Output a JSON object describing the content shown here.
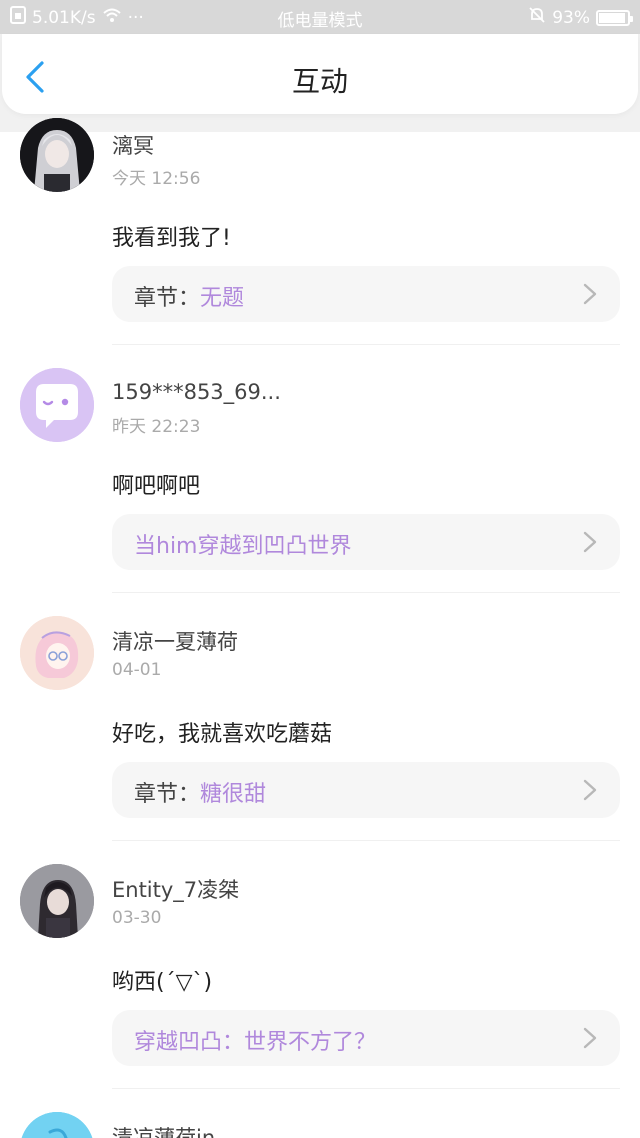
{
  "status_bar": {
    "network_speed": "5.01K/s",
    "dots": "···",
    "mode": "低电量模式",
    "battery_percent": "93%",
    "battery_level": 0.93
  },
  "header": {
    "title": "互动"
  },
  "comments": [
    {
      "name": "漓冥",
      "time": "今天 12:56",
      "text": "我看到我了!",
      "link_prefix": "章节：",
      "link_value": "无题"
    },
    {
      "name": "159***853_69...",
      "time": "昨天 22:23",
      "text": "啊吧啊吧",
      "link_prefix": "",
      "link_value": "当him穿越到凹凸世界"
    },
    {
      "name": "清凉一夏薄荷",
      "time": "04-01",
      "text": "好吃，我就喜欢吃蘑菇",
      "link_prefix": "章节：",
      "link_value": "糖很甜"
    },
    {
      "name": "Entity_7凌桀",
      "time": "03-30",
      "text": "哟西(ˊ▽ˋ)",
      "link_prefix": "",
      "link_value": "穿越凹凸：世界不方了？"
    },
    {
      "name": "清凉薄荷in"
    }
  ],
  "colors": {
    "accent_blue": "#2ba0f0",
    "link_purple": "#b088dc"
  }
}
